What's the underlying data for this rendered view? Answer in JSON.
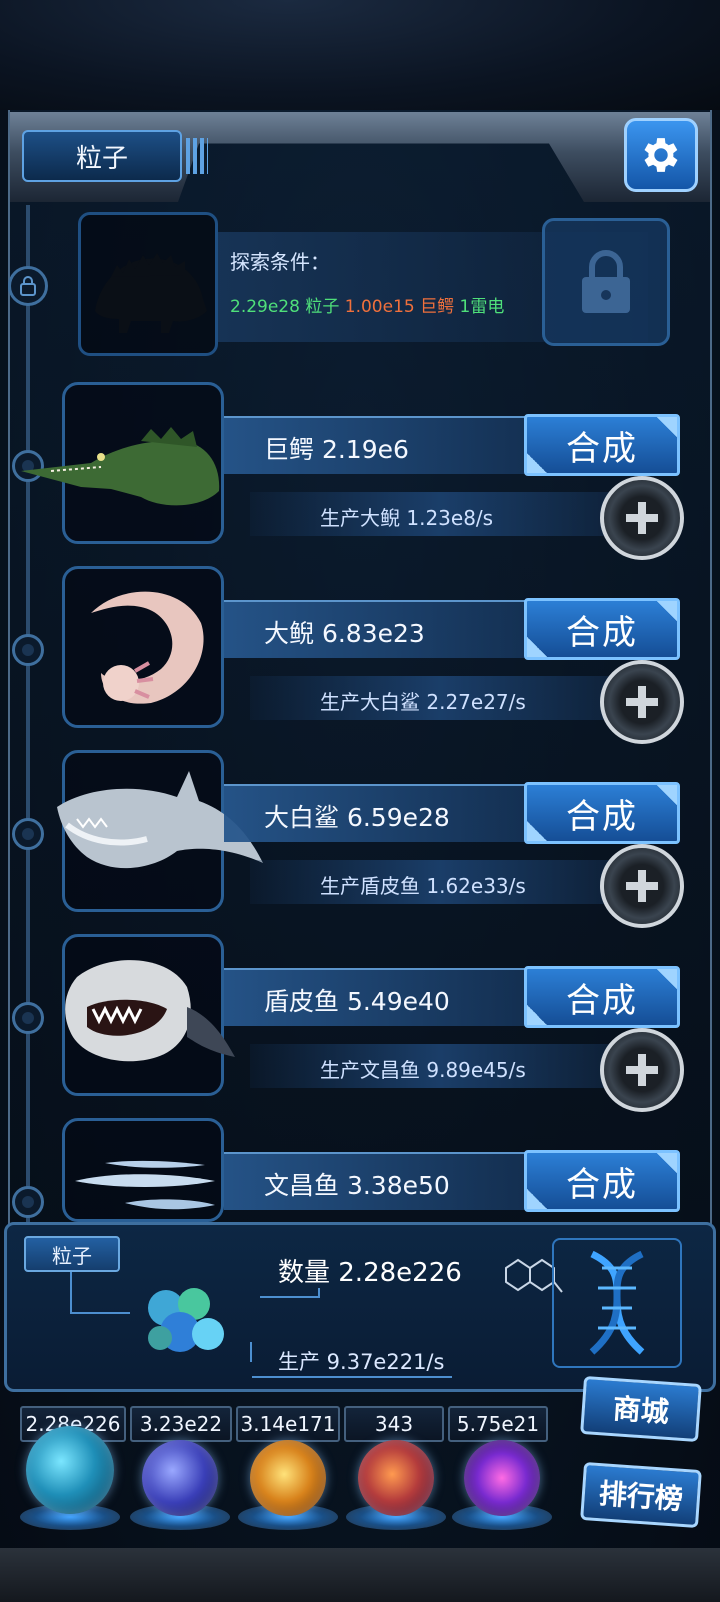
{
  "header": {
    "tab_label": "粒子",
    "settings_icon": "gear-icon"
  },
  "explore": {
    "title": "探索条件：",
    "cond_1": "2.29e28 粒子",
    "cond_2": "1.00e15 巨鳄",
    "cond_3": "1雷电",
    "lock_icon": "padlock-icon"
  },
  "creatures": [
    {
      "name": "巨鳄 2.19e6",
      "production": "生产大鲵 1.23e8/s",
      "synth_label": "合成"
    },
    {
      "name": "大鲵 6.83e23",
      "production": "生产大白鲨 2.27e27/s",
      "synth_label": "合成"
    },
    {
      "name": "大白鲨 6.59e28",
      "production": "生产盾皮鱼 1.62e33/s",
      "synth_label": "合成"
    },
    {
      "name": "盾皮鱼 5.49e40",
      "production": "生产文昌鱼 9.89e45/s",
      "synth_label": "合成"
    },
    {
      "name": "文昌鱼 3.38e50",
      "production": "",
      "synth_label": "合成"
    }
  ],
  "bottom": {
    "tab_label": "粒子",
    "quantity": "数量 2.28e226",
    "production": "生产 9.37e221/s"
  },
  "resources": [
    {
      "value": "2.28e226",
      "icon": "particle-orb-icon"
    },
    {
      "value": "3.23e22",
      "icon": "lightning-orb-icon"
    },
    {
      "value": "3.14e171",
      "icon": "fire-orb-icon"
    },
    {
      "value": "343",
      "icon": "brain-orb-icon"
    },
    {
      "value": "5.75e21",
      "icon": "vortex-orb-icon"
    }
  ],
  "side_buttons": {
    "shop": "商城",
    "ranking": "排行榜"
  },
  "colors": {
    "accent": "#2c7fd6",
    "green": "#4fe07a",
    "orange": "#f0703c"
  }
}
